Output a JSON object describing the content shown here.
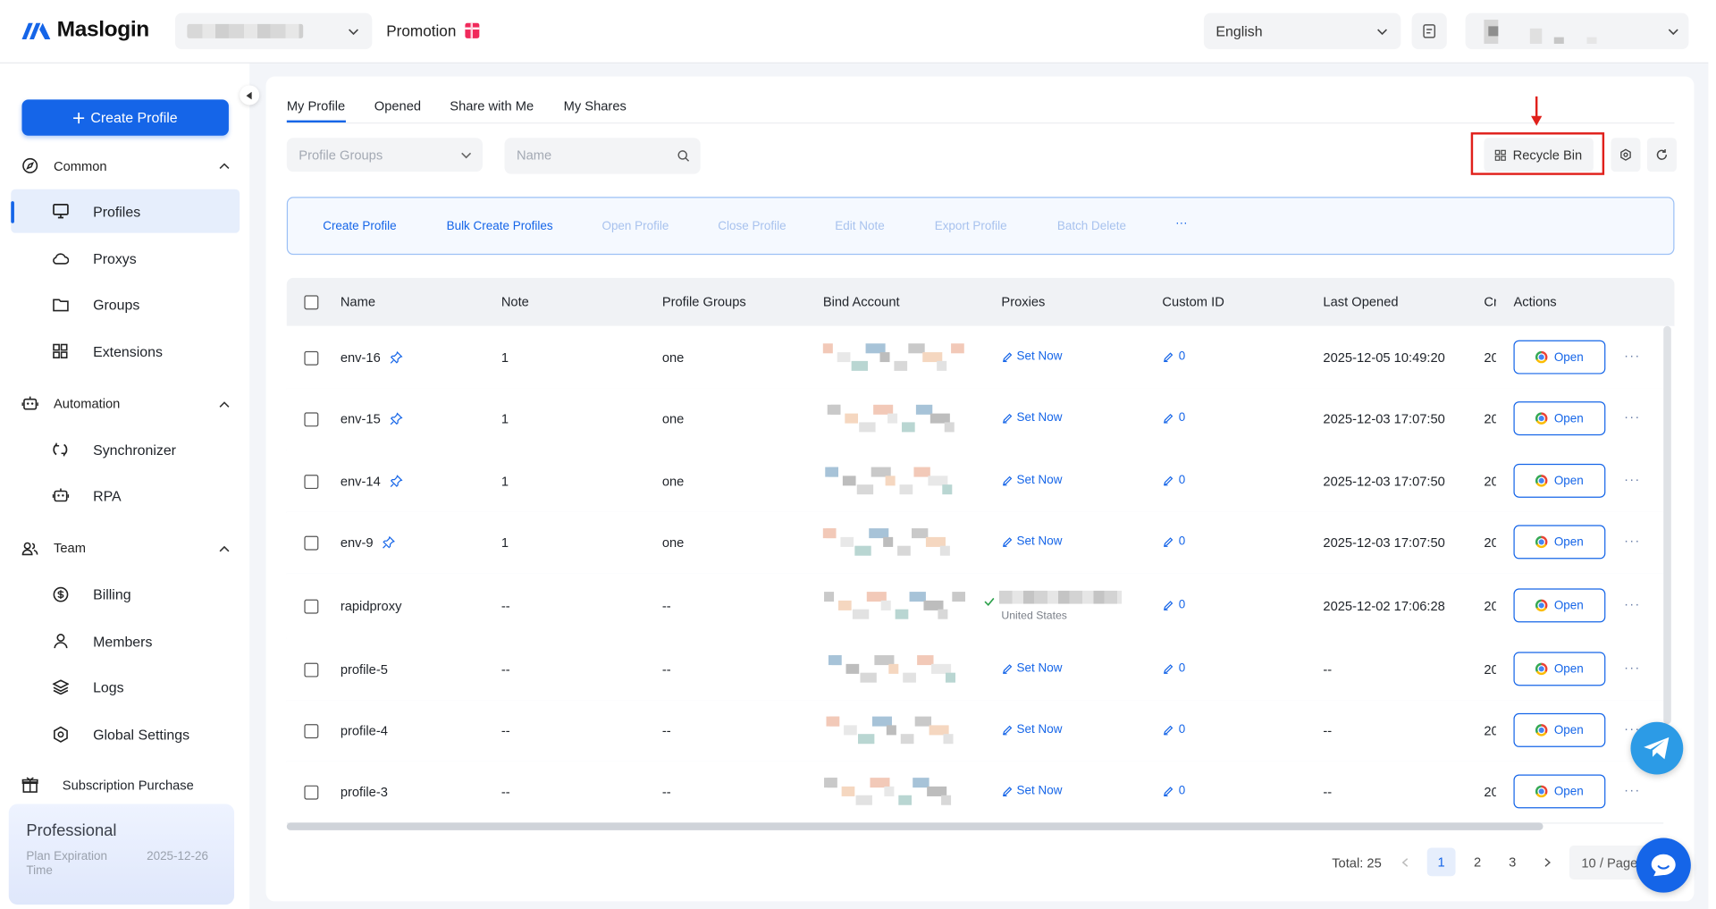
{
  "app": {
    "name": "Maslogin",
    "brand_color": "#1565e8"
  },
  "header": {
    "promotion_label": "Promotion",
    "language": "English"
  },
  "sidebar": {
    "create_button": "Create Profile",
    "sections": [
      {
        "label": "Common",
        "items": [
          {
            "label": "Profiles",
            "icon": "monitor-icon",
            "active": true
          },
          {
            "label": "Proxys",
            "icon": "cloud-icon"
          },
          {
            "label": "Groups",
            "icon": "folder-icon"
          },
          {
            "label": "Extensions",
            "icon": "grid-icon"
          }
        ]
      },
      {
        "label": "Automation",
        "items": [
          {
            "label": "Synchronizer",
            "icon": "sync-icon"
          },
          {
            "label": "RPA",
            "icon": "robot-icon"
          }
        ]
      },
      {
        "label": "Team",
        "items": [
          {
            "label": "Billing",
            "icon": "billing-icon"
          },
          {
            "label": "Members",
            "icon": "user-icon"
          },
          {
            "label": "Logs",
            "icon": "layers-icon"
          },
          {
            "label": "Global Settings",
            "icon": "settings-icon"
          }
        ]
      }
    ],
    "subscription_purchase": "Subscription Purchase",
    "plan": {
      "name": "Professional",
      "expiration_label": "Plan Expiration Time",
      "expiration_value": "2025-12-26"
    }
  },
  "tabs": [
    "My Profile",
    "Opened",
    "Share with Me",
    "My Shares"
  ],
  "filters": {
    "group_placeholder": "Profile Groups",
    "name_placeholder": "Name"
  },
  "toolbar": {
    "recycle_bin": "Recycle Bin"
  },
  "bulk_actions": [
    {
      "label": "Create Profile",
      "enabled": true
    },
    {
      "label": "Bulk Create Profiles",
      "enabled": true
    },
    {
      "label": "Open Profile",
      "enabled": false
    },
    {
      "label": "Close Profile",
      "enabled": false
    },
    {
      "label": "Edit Note",
      "enabled": false
    },
    {
      "label": "Export Profile",
      "enabled": false
    },
    {
      "label": "Batch Delete",
      "enabled": false
    },
    {
      "label": "···",
      "enabled": true
    }
  ],
  "table": {
    "columns": [
      "Name",
      "Note",
      "Profile Groups",
      "Bind Account",
      "Proxies",
      "Custom ID",
      "Last Opened",
      "Cr",
      "Actions"
    ],
    "set_now_label": "Set Now",
    "open_label": "Open",
    "rows": [
      {
        "name": "env-16",
        "pinned": true,
        "note": "1",
        "group": "one",
        "bind_account": "",
        "proxy": "",
        "proxy_location": "",
        "custom_id": "0",
        "last_opened": "2025-12-05 10:49:20",
        "created": "20"
      },
      {
        "name": "env-15",
        "pinned": true,
        "note": "1",
        "group": "one",
        "bind_account": "",
        "proxy": "",
        "proxy_location": "",
        "custom_id": "0",
        "last_opened": "2025-12-03 17:07:50",
        "created": "20"
      },
      {
        "name": "env-14",
        "pinned": true,
        "note": "1",
        "group": "one",
        "bind_account": "",
        "proxy": "",
        "proxy_location": "",
        "custom_id": "0",
        "last_opened": "2025-12-03 17:07:50",
        "created": "20"
      },
      {
        "name": "env-9",
        "pinned": true,
        "note": "1",
        "group": "one",
        "bind_account": "",
        "proxy": "",
        "proxy_location": "",
        "custom_id": "0",
        "last_opened": "2025-12-03 17:07:50",
        "created": "20"
      },
      {
        "name": "rapidproxy",
        "pinned": false,
        "note": "--",
        "group": "--",
        "bind_account": "",
        "proxy": "configured",
        "proxy_location": "United States",
        "custom_id": "0",
        "last_opened": "2025-12-02 17:06:28",
        "created": "20"
      },
      {
        "name": "profile-5",
        "pinned": false,
        "note": "--",
        "group": "--",
        "bind_account": "",
        "proxy": "",
        "proxy_location": "",
        "custom_id": "0",
        "last_opened": "--",
        "created": "20"
      },
      {
        "name": "profile-4",
        "pinned": false,
        "note": "--",
        "group": "--",
        "bind_account": "",
        "proxy": "",
        "proxy_location": "",
        "custom_id": "0",
        "last_opened": "--",
        "created": "20"
      },
      {
        "name": "profile-3",
        "pinned": false,
        "note": "--",
        "group": "--",
        "bind_account": "",
        "proxy": "",
        "proxy_location": "",
        "custom_id": "0",
        "last_opened": "--",
        "created": "20"
      }
    ]
  },
  "pagination": {
    "total": "Total: 25",
    "pages": [
      "1",
      "2",
      "3"
    ],
    "current": "1",
    "page_size": "10 / Page"
  },
  "highlight_color": "#e0201b"
}
